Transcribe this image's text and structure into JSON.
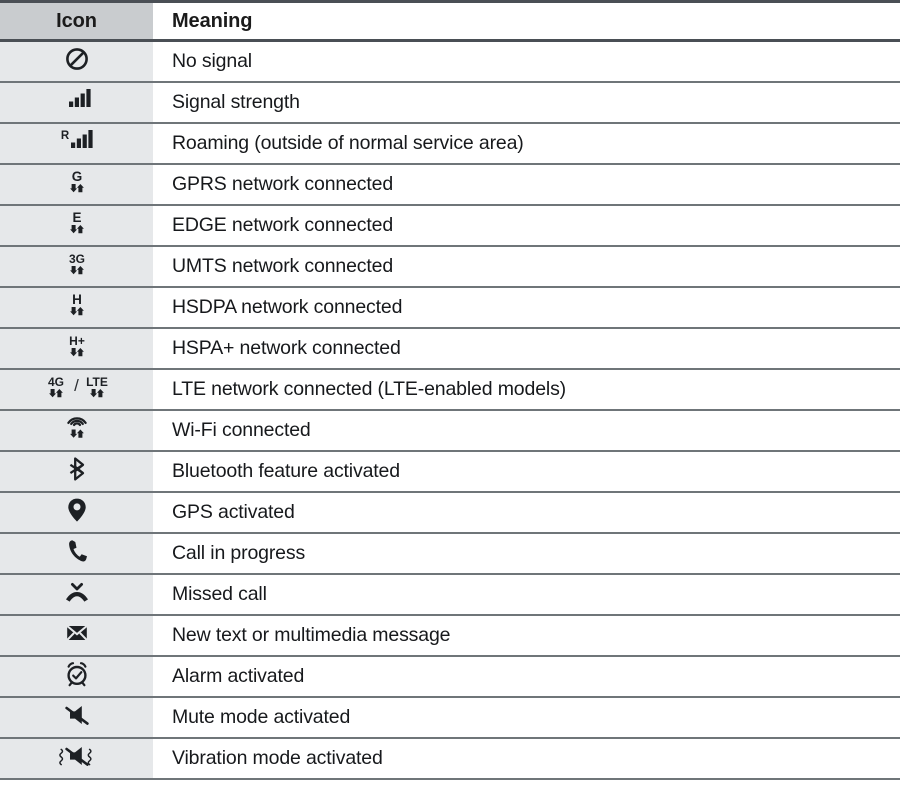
{
  "table": {
    "columns": [
      {
        "key": "icon",
        "label": "Icon"
      },
      {
        "key": "meaning",
        "label": "Meaning"
      }
    ],
    "rows": [
      {
        "icon_name": "no-signal-icon",
        "icon_text": "",
        "meaning": "No signal"
      },
      {
        "icon_name": "signal-strength-icon",
        "icon_text": "",
        "meaning": "Signal strength"
      },
      {
        "icon_name": "roaming-icon",
        "icon_text": "R",
        "meaning": "Roaming (outside of normal service area)"
      },
      {
        "icon_name": "gprs-network-icon",
        "icon_text": "G",
        "meaning": "GPRS network connected"
      },
      {
        "icon_name": "edge-network-icon",
        "icon_text": "E",
        "meaning": "EDGE network connected"
      },
      {
        "icon_name": "umts-network-icon",
        "icon_text": "3G",
        "meaning": "UMTS network connected"
      },
      {
        "icon_name": "hsdpa-network-icon",
        "icon_text": "H",
        "meaning": "HSDPA network connected"
      },
      {
        "icon_name": "hspa-plus-network-icon",
        "icon_text": "H+",
        "meaning": "HSPA+ network connected"
      },
      {
        "icon_name": "lte-network-icon",
        "icon_text": "4G / LTE",
        "meaning": "LTE network connected (LTE-enabled models)"
      },
      {
        "icon_name": "wifi-connected-icon",
        "icon_text": "",
        "meaning": "Wi-Fi connected"
      },
      {
        "icon_name": "bluetooth-icon",
        "icon_text": "",
        "meaning": "Bluetooth feature activated"
      },
      {
        "icon_name": "gps-icon",
        "icon_text": "",
        "meaning": "GPS activated"
      },
      {
        "icon_name": "call-in-progress-icon",
        "icon_text": "",
        "meaning": "Call in progress"
      },
      {
        "icon_name": "missed-call-icon",
        "icon_text": "",
        "meaning": "Missed call"
      },
      {
        "icon_name": "new-message-icon",
        "icon_text": "",
        "meaning": "New text or multimedia message"
      },
      {
        "icon_name": "alarm-icon",
        "icon_text": "",
        "meaning": "Alarm activated"
      },
      {
        "icon_name": "mute-mode-icon",
        "icon_text": "",
        "meaning": "Mute mode activated"
      },
      {
        "icon_name": "vibration-mode-icon",
        "icon_text": "",
        "meaning": "Vibration mode activated"
      }
    ]
  },
  "colors": {
    "header_background": "#c9cccf",
    "icon_cell_background": "#e6e8ea",
    "meaning_cell_background": "#ffffff",
    "rule": "#6f7579",
    "text": "#17191c"
  }
}
